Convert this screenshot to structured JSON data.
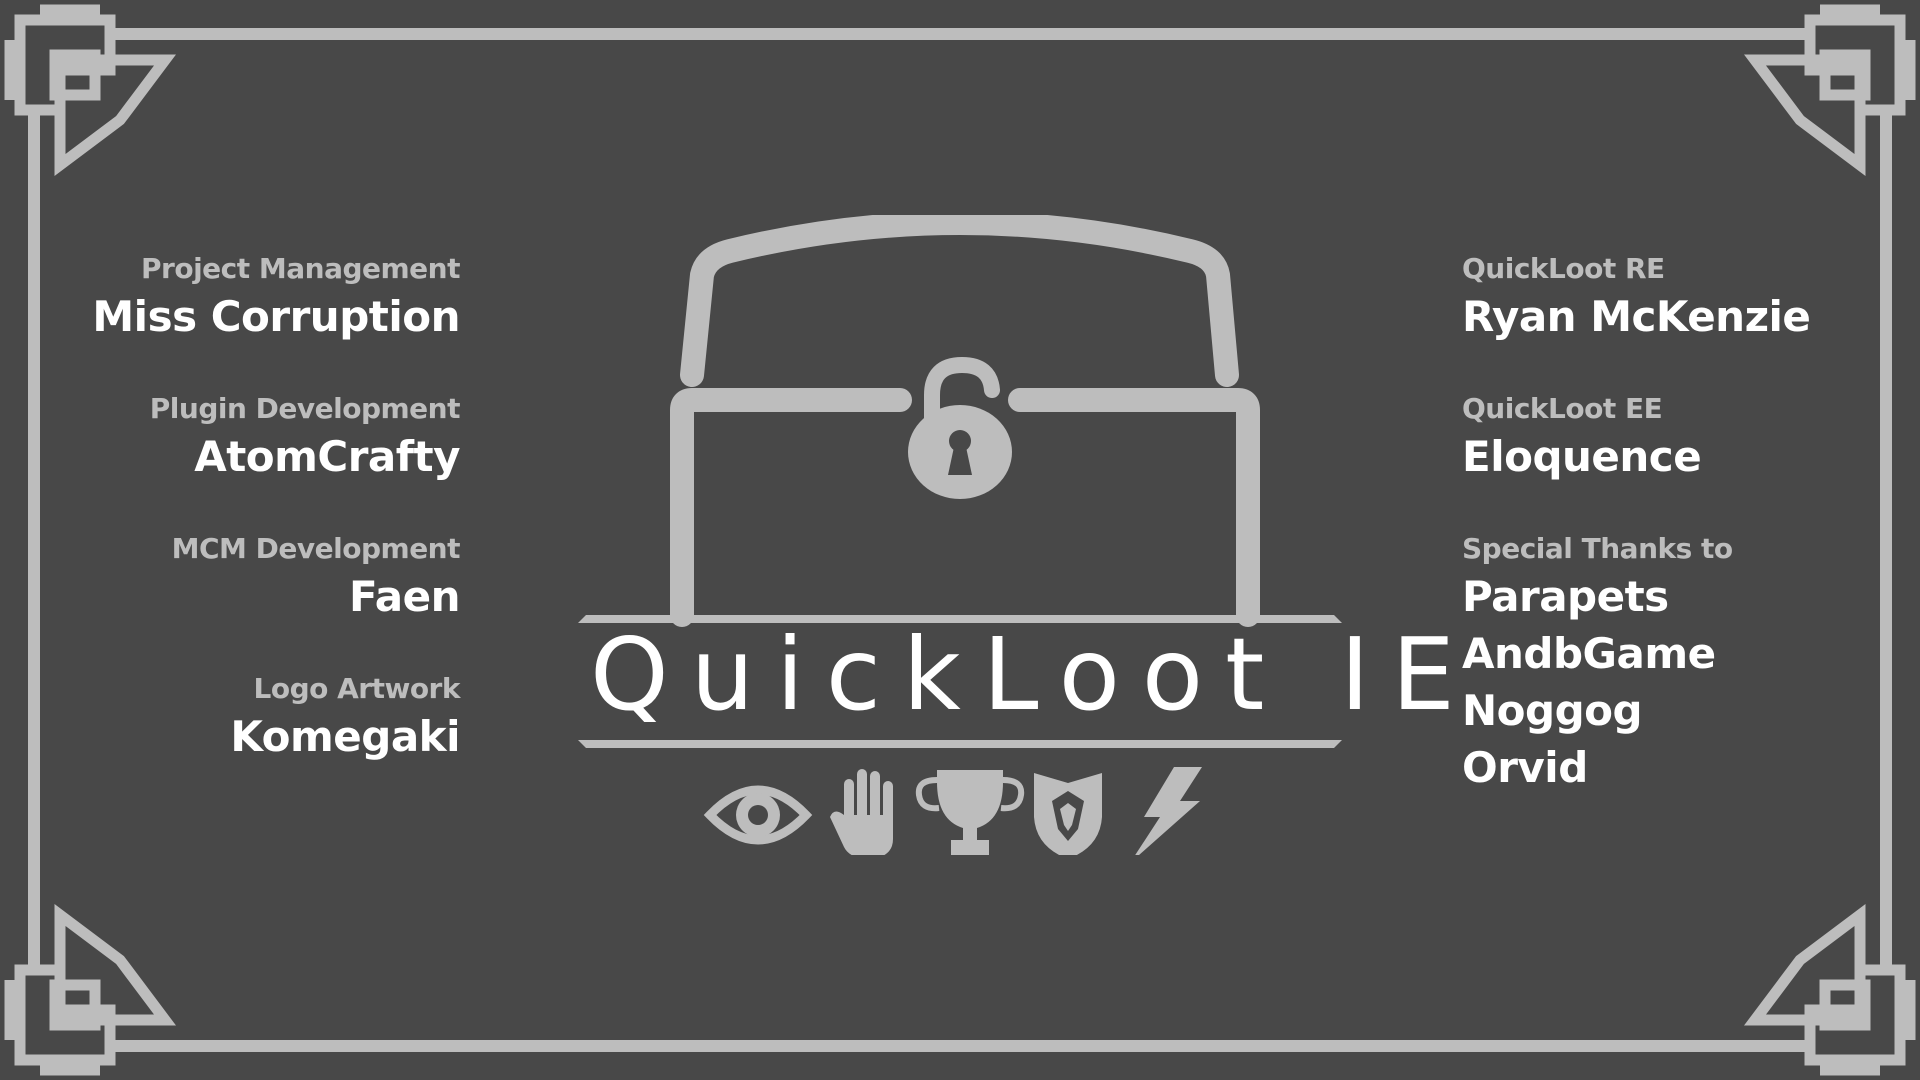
{
  "logo": {
    "title": "QuickLoot IE"
  },
  "credits_left": [
    {
      "role": "Project Management",
      "name": "Miss Corruption"
    },
    {
      "role": "Plugin Development",
      "name": "AtomCrafty"
    },
    {
      "role": "MCM Development",
      "name": "Faen"
    },
    {
      "role": "Logo Artwork",
      "name": "Komegaki"
    }
  ],
  "credits_right": [
    {
      "role": "QuickLoot RE",
      "name": "Ryan McKenzie"
    },
    {
      "role": "QuickLoot EE",
      "name": "Eloquence"
    }
  ],
  "special_thanks": {
    "role": "Special Thanks to",
    "names": [
      "Parapets",
      "AndbGame",
      "Noggog",
      "Orvid"
    ]
  },
  "icons": [
    "eye-icon",
    "hand-icon",
    "trophy-icon",
    "dragon-shield-icon",
    "lightning-icon"
  ],
  "colors": {
    "background": "#484848",
    "frame": "#bdbdbd",
    "text_primary": "#ffffff",
    "text_secondary": "#bdbdbd"
  }
}
